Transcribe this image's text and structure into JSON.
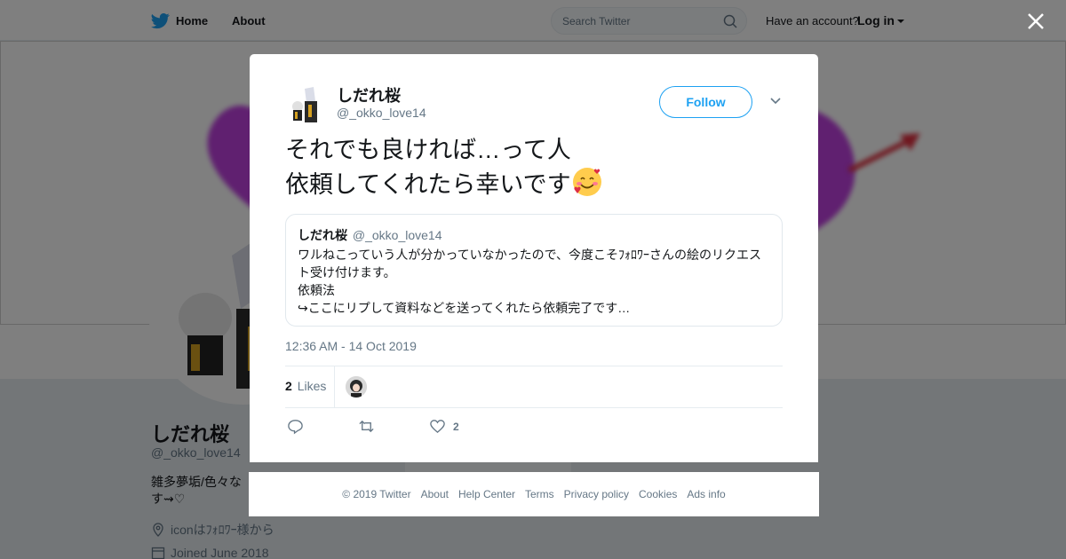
{
  "topbar": {
    "home_label": "Home",
    "about_label": "About",
    "search_placeholder": "Search Twitter",
    "account_prompt": "Have an account?",
    "login_label": "Log in"
  },
  "profile": {
    "name": "しだれ桜",
    "handle": "@_okko_love14",
    "bio": "雑多夢垢/色々な…す⇝♡",
    "bio_line1": "雑多夢垢/色々な",
    "bio_line2": "す⇝♡",
    "location": "iconはﾌｫﾛﾜｰ様から",
    "joined": "Joined June 2018"
  },
  "modal": {
    "author_name": "しだれ桜",
    "author_handle": "@_okko_love14",
    "follow_label": "Follow",
    "tweet_line1": "それでも良ければ…って人",
    "tweet_line2": "依頼してくれたら幸いです",
    "tweet_emoji": "smiling-face-with-hearts-emoji",
    "quote": {
      "name": "しだれ桜",
      "handle": "@_okko_love14",
      "line1": "ワルねこっていう人が分かっていなかったので、今度こそﾌｫﾛﾜｰさんの絵のリクエス",
      "line2": "ト受け付けます。",
      "line3": "依頼法",
      "line4": "↪ここにリプして資料などを送ってくれたら依頼完了です…"
    },
    "timestamp": "12:36 AM - 14 Oct 2019",
    "likes_count": "2",
    "likes_label": "Likes",
    "like_action_count": "2"
  },
  "footer": {
    "copyright": "© 2019 Twitter",
    "links": [
      "About",
      "Help Center",
      "Terms",
      "Privacy policy",
      "Cookies",
      "Ads info"
    ]
  },
  "colors": {
    "twitter_blue": "#1da1f2",
    "secondary_text": "#657786",
    "heart_purple": "#c040e0",
    "arrow_red": "#e03040"
  }
}
